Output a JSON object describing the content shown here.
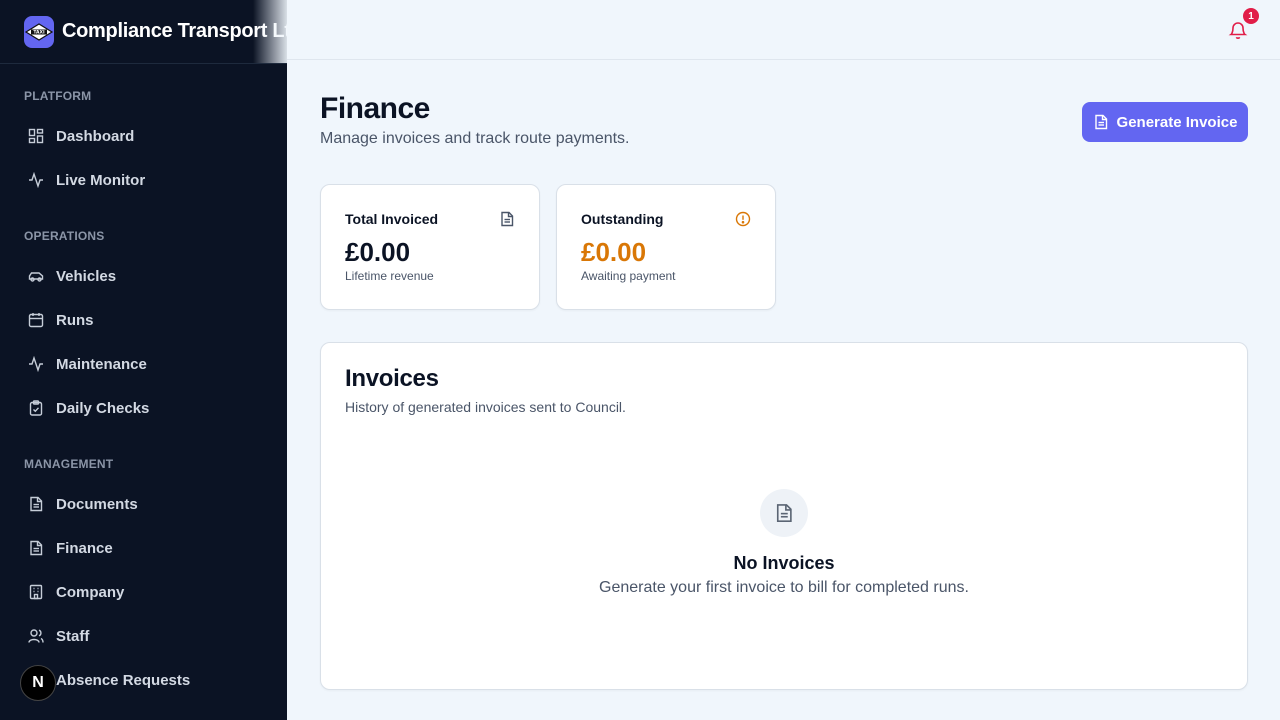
{
  "brand": {
    "name": "Compliance Transport Ltd",
    "logo_text": "TAXI"
  },
  "sidebar": {
    "sections": [
      {
        "title": "PLATFORM",
        "items": [
          {
            "label": "Dashboard",
            "icon": "grid-icon"
          },
          {
            "label": "Live Monitor",
            "icon": "activity-icon"
          }
        ]
      },
      {
        "title": "OPERATIONS",
        "items": [
          {
            "label": "Vehicles",
            "icon": "car-icon"
          },
          {
            "label": "Runs",
            "icon": "calendar-icon"
          },
          {
            "label": "Maintenance",
            "icon": "activity-icon"
          },
          {
            "label": "Daily Checks",
            "icon": "clipboard-check-icon"
          }
        ]
      },
      {
        "title": "MANAGEMENT",
        "items": [
          {
            "label": "Documents",
            "icon": "file-icon"
          },
          {
            "label": "Finance",
            "icon": "file-icon"
          },
          {
            "label": "Company",
            "icon": "building-icon"
          },
          {
            "label": "Staff",
            "icon": "users-icon"
          },
          {
            "label": "Absence Requests",
            "icon": "calendar-icon"
          }
        ]
      }
    ],
    "dev_badge": "N"
  },
  "topbar": {
    "notification_count": "1"
  },
  "page": {
    "title": "Finance",
    "subtitle": "Manage invoices and track route payments.",
    "generate_button": "Generate Invoice"
  },
  "stats": [
    {
      "label": "Total Invoiced",
      "value": "£0.00",
      "sub": "Lifetime revenue",
      "icon": "file-icon",
      "color": "#0b1324"
    },
    {
      "label": "Outstanding",
      "value": "£0.00",
      "sub": "Awaiting payment",
      "icon": "alert-circle-icon",
      "color": "#d97706"
    }
  ],
  "invoices": {
    "title": "Invoices",
    "subtitle": "History of generated invoices sent to Council.",
    "empty_title": "No Invoices",
    "empty_subtitle": "Generate your first invoice to bill for completed runs."
  },
  "colors": {
    "accent": "#6366f1",
    "sidebar_bg": "#0b1324",
    "warning": "#d97706",
    "badge": "#e11d48"
  }
}
